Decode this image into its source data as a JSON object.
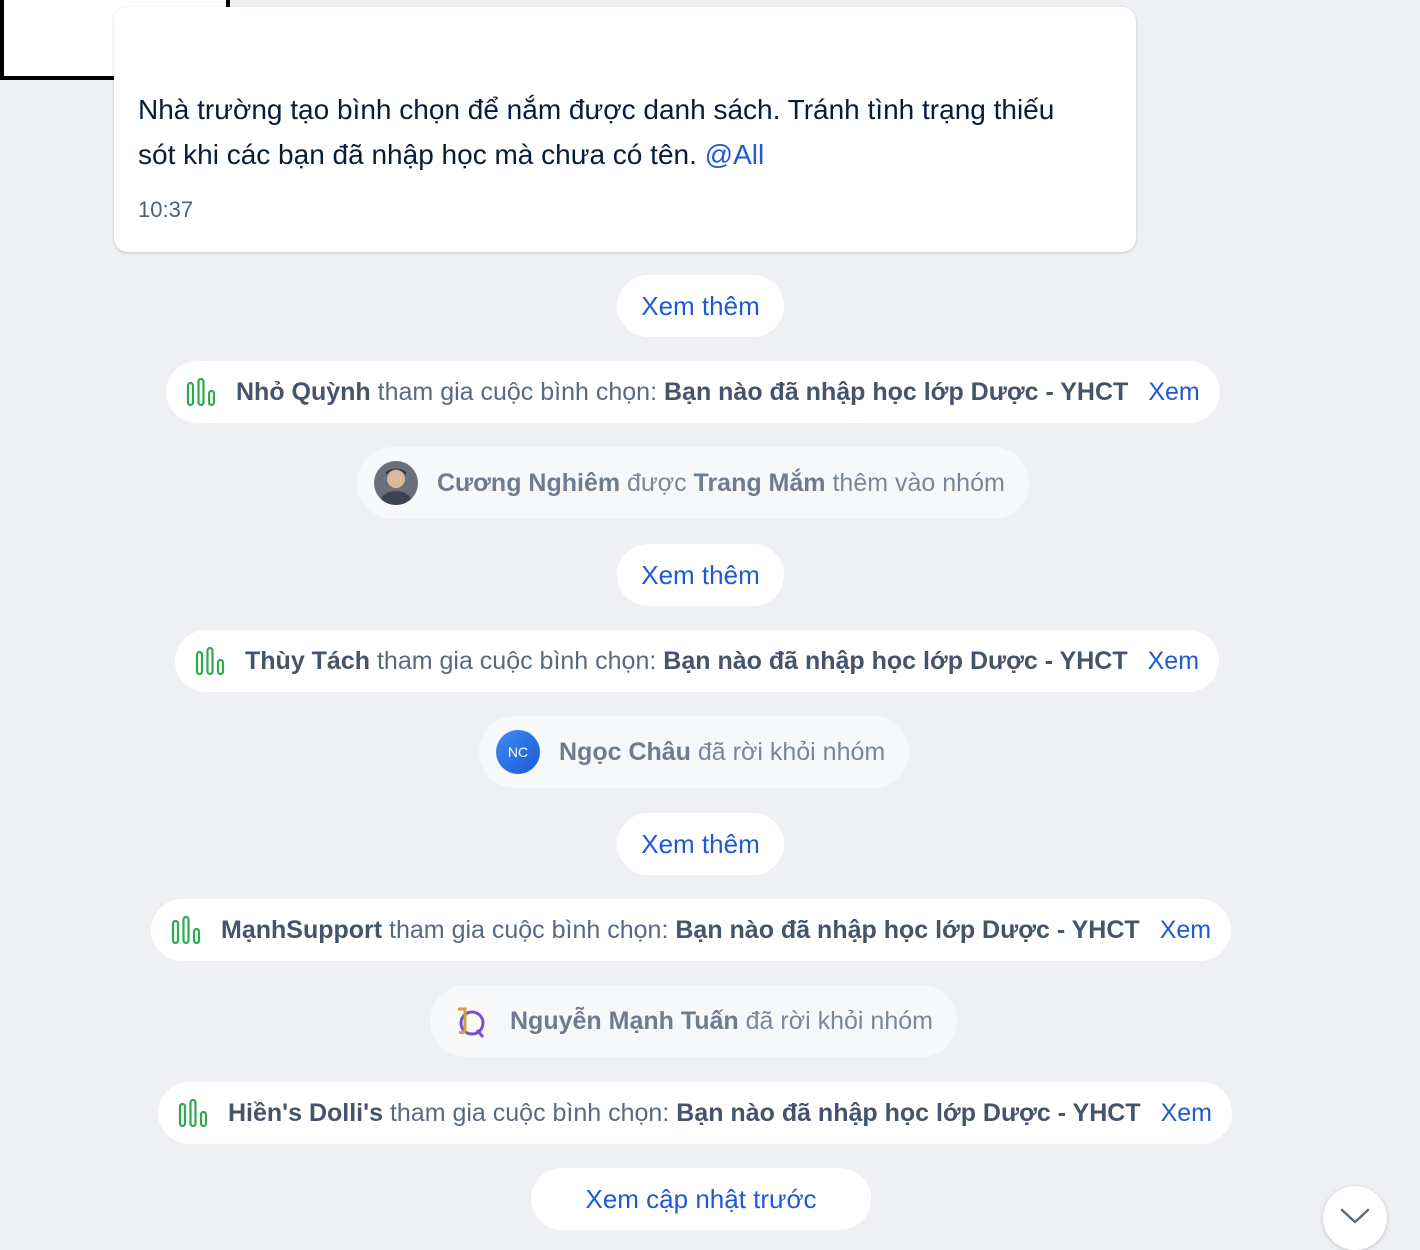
{
  "message": {
    "text": "Nhà trường tạo bình chọn để nắm được danh sách. Tránh tình trạng thiếu sót khi các bạn đã nhập học mà chưa có tên.",
    "mention": "@All",
    "time": "10:37"
  },
  "see_more_label": "Xem thêm",
  "see_previous_label": "Xem cập nhật trước",
  "poll_action": "tham gia cuộc bình chọn:",
  "poll_title": "Bạn nào đã nhập học lớp Dược - YHCT",
  "poll_view": "Xem",
  "polls": [
    {
      "name": "Nhỏ Quỳnh"
    },
    {
      "name": "Thùy Tách"
    },
    {
      "name": "MạnhSupport"
    },
    {
      "name": "Hiền's Dolli's"
    }
  ],
  "system_events": [
    {
      "name": "Cương Nghiêm",
      "middle": "được",
      "actor": "Trang Mắm",
      "action": "thêm vào nhóm",
      "avatar": "photo"
    },
    {
      "name": "Ngọc Châu",
      "action": "đã rời khỏi nhóm",
      "avatar_initials": "NC"
    },
    {
      "name": "Nguyễn Mạnh Tuấn",
      "action": "đã rời khỏi nhóm",
      "avatar": "logo"
    }
  ],
  "icons": {
    "poll": "poll-chart-icon",
    "scroll": "chevron-down-icon"
  },
  "colors": {
    "link": "#1f5ad6",
    "poll_icon": "#2eaa4f",
    "background": "#eef0f3"
  }
}
